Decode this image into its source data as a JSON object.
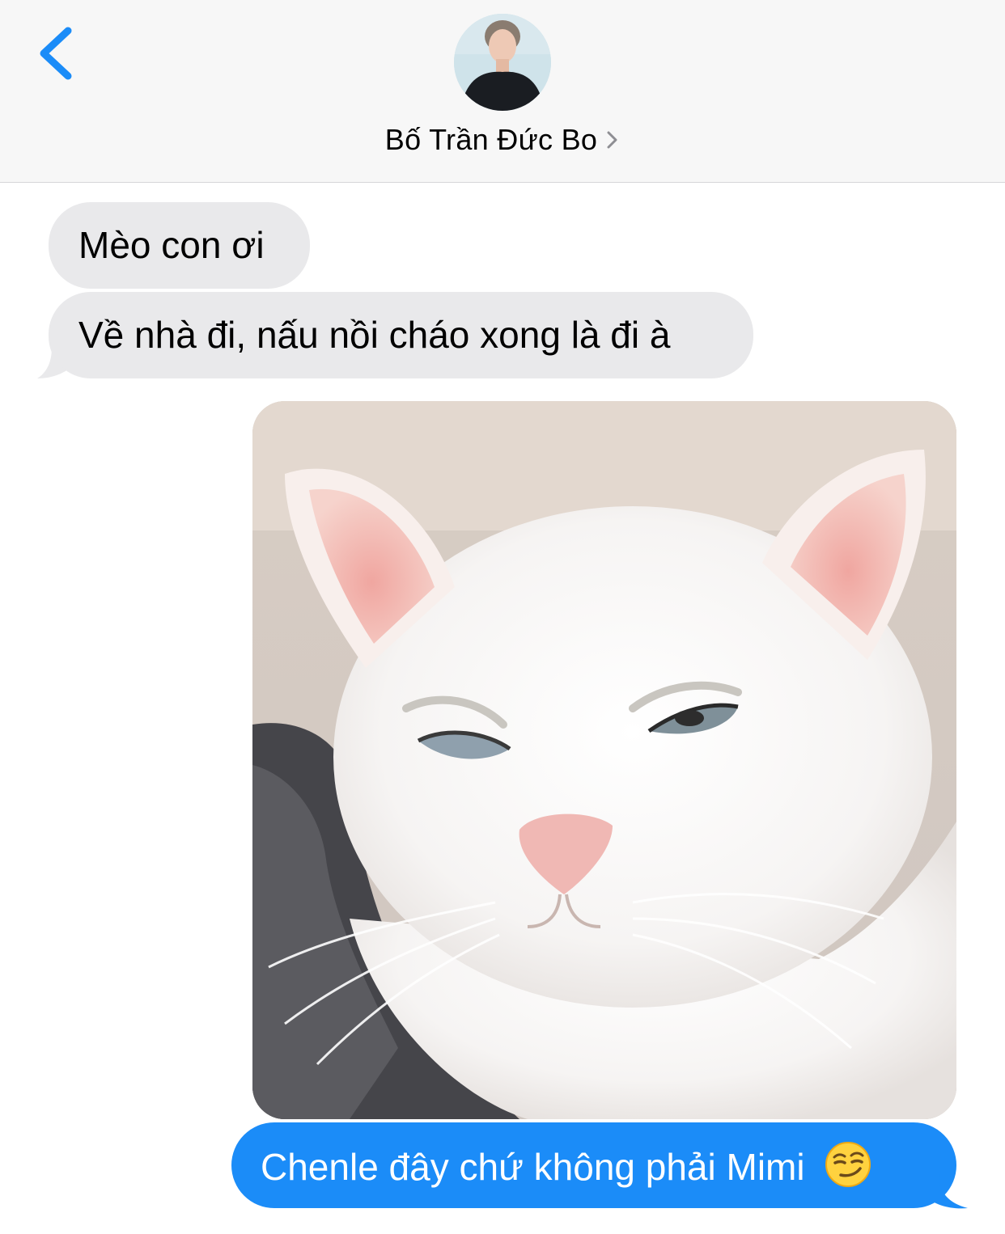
{
  "header": {
    "contact_name": "Bố Trần Đức Bo",
    "accent_color": "#1b8cf8"
  },
  "messages": [
    {
      "direction": "received",
      "text": "Mèo con ơi"
    },
    {
      "direction": "received",
      "text": "Về nhà đi, nấu nồi cháo xong là đi à"
    },
    {
      "direction": "sent",
      "type": "image",
      "alt": "white-cat-photo"
    },
    {
      "direction": "sent",
      "text": "Chenle đây chứ không phải Mimi",
      "emoji": "smirking-face"
    }
  ],
  "colors": {
    "received_bubble": "#e9e9eb",
    "sent_bubble": "#1b8cf8",
    "header_bg": "#f7f7f7"
  }
}
